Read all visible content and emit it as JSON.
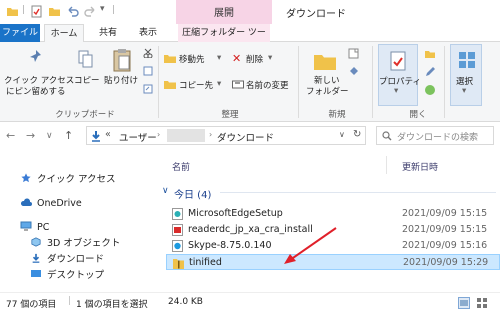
{
  "context_tab": "展開",
  "window_title": "ダウンロード",
  "tabs": {
    "file": "ファイル",
    "home": "ホーム",
    "share": "共有",
    "view": "表示",
    "compress": "圧縮フォルダー ツール"
  },
  "ribbon": {
    "pin_line1": "クイック アクセス",
    "pin_line2": "にピン留めする",
    "copy": "コピー",
    "paste": "貼り付け",
    "move_to": "移動先",
    "copy_to": "コピー先",
    "delete": "削除",
    "rename": "名前の変更",
    "new_folder_line1": "新しい",
    "new_folder_line2": "フォルダー",
    "properties": "プロパティ",
    "select": "選択",
    "group_clipboard": "クリップボード",
    "group_organize": "整理",
    "group_new": "新規",
    "group_open": "開く"
  },
  "address": {
    "crumb_prefix": "«",
    "user": "ユーザー",
    "folder": "ダウンロード",
    "search_placeholder": "ダウンロードの検索"
  },
  "nav": {
    "quick_access": "クイック アクセス",
    "onedrive": "OneDrive",
    "pc": "PC",
    "objects3d": "3D オブジェクト",
    "downloads": "ダウンロード",
    "desktop": "デスクトップ"
  },
  "columns": {
    "name": "名前",
    "modified": "更新日時"
  },
  "group_header": "今日 (4)",
  "files": [
    {
      "name": "MicrosoftEdgeSetup",
      "date": "2021/09/09 15:15",
      "icon": "edge-setup-icon"
    },
    {
      "name": "readerdc_jp_xa_cra_install",
      "date": "2021/09/09 15:15",
      "icon": "pdf-installer-icon"
    },
    {
      "name": "Skype-8.75.0.140",
      "date": "2021/09/09 15:16",
      "icon": "skype-installer-icon"
    },
    {
      "name": "tinified",
      "date": "2021/09/09 15:29",
      "icon": "zip-folder-icon"
    }
  ],
  "status": {
    "count": "77 個の項目",
    "selected": "1 個の項目を選択",
    "size": "24.0 KB"
  },
  "colors": {
    "file_tab": "#1a73c8",
    "context_tab": "#f7d4e6",
    "selection": "#cce8ff",
    "arrow": "#e0202a"
  }
}
